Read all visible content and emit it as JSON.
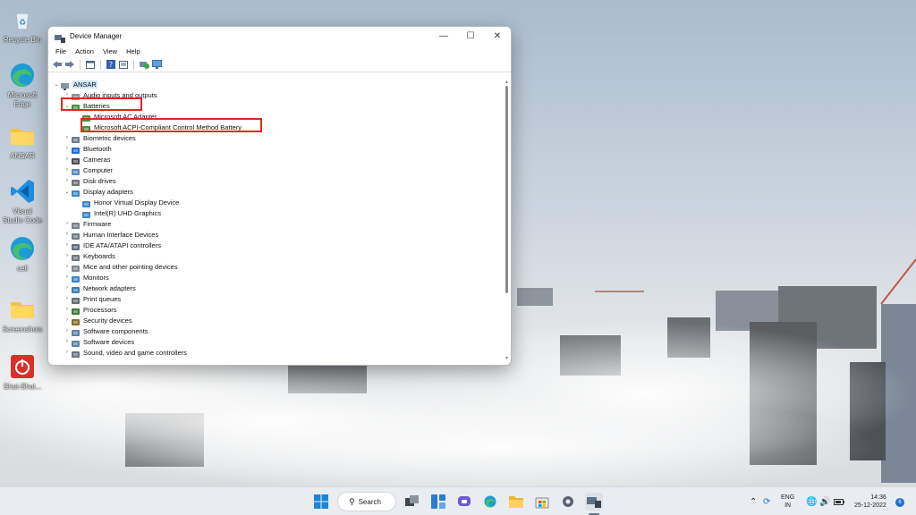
{
  "desktop": {
    "icons": [
      {
        "label": "Recycle Bin",
        "icon": "recycle-bin-icon"
      },
      {
        "label": "Microsoft Edge",
        "icon": "edge-icon"
      },
      {
        "label": "ANSAR",
        "icon": "folder-icon"
      },
      {
        "label": "Visual Studio Code",
        "icon": "vscode-icon"
      },
      {
        "label": "cell",
        "icon": "edge-icon"
      },
      {
        "label": "Screenshots",
        "icon": "folder-icon"
      },
      {
        "label": "Shut-Shut...",
        "icon": "power-icon"
      }
    ]
  },
  "window": {
    "title": "Device Manager",
    "controls": {
      "minimize": "—",
      "maximize": "☐",
      "close": "✕"
    },
    "menu": [
      "File",
      "Action",
      "View",
      "Help"
    ],
    "toolbar_icons": [
      "back-icon",
      "forward-icon",
      "properties-icon",
      "help-icon",
      "view-icon",
      "update-driver-icon",
      "monitor-icon"
    ]
  },
  "tree": {
    "root": "ANSAR",
    "items": [
      {
        "label": "Audio inputs and outputs",
        "icon": "speaker-icon",
        "expanded": false,
        "level": 1
      },
      {
        "label": "Batteries",
        "icon": "battery-icon",
        "expanded": true,
        "level": 1
      },
      {
        "label": "Microsoft AC Adapter",
        "icon": "battery-icon",
        "level": 2
      },
      {
        "label": "Microsoft ACPI-Compliant Control Method Battery",
        "icon": "battery-icon",
        "level": 2
      },
      {
        "label": "Biometric devices",
        "icon": "biometric-icon",
        "expanded": false,
        "level": 1
      },
      {
        "label": "Bluetooth",
        "icon": "bluetooth-icon",
        "expanded": false,
        "level": 1
      },
      {
        "label": "Cameras",
        "icon": "camera-icon",
        "expanded": false,
        "level": 1
      },
      {
        "label": "Computer",
        "icon": "computer-icon",
        "expanded": false,
        "level": 1
      },
      {
        "label": "Disk drives",
        "icon": "disk-icon",
        "expanded": false,
        "level": 1
      },
      {
        "label": "Display adapters",
        "icon": "display-icon",
        "expanded": true,
        "level": 1
      },
      {
        "label": "Honor Virtual Display Device",
        "icon": "display-icon",
        "level": 2
      },
      {
        "label": "Intel(R) UHD Graphics",
        "icon": "display-icon",
        "level": 2
      },
      {
        "label": "Firmware",
        "icon": "firmware-icon",
        "expanded": false,
        "level": 1
      },
      {
        "label": "Human Interface Devices",
        "icon": "hid-icon",
        "expanded": false,
        "level": 1
      },
      {
        "label": "IDE ATA/ATAPI controllers",
        "icon": "ide-icon",
        "expanded": false,
        "level": 1
      },
      {
        "label": "Keyboards",
        "icon": "keyboard-icon",
        "expanded": false,
        "level": 1
      },
      {
        "label": "Mice and other pointing devices",
        "icon": "mouse-icon",
        "expanded": false,
        "level": 1
      },
      {
        "label": "Monitors",
        "icon": "monitor-icon",
        "expanded": false,
        "level": 1
      },
      {
        "label": "Network adapters",
        "icon": "network-icon",
        "expanded": false,
        "level": 1
      },
      {
        "label": "Print queues",
        "icon": "printer-icon",
        "expanded": false,
        "level": 1
      },
      {
        "label": "Processors",
        "icon": "processor-icon",
        "expanded": false,
        "level": 1
      },
      {
        "label": "Security devices",
        "icon": "security-icon",
        "expanded": false,
        "level": 1
      },
      {
        "label": "Software components",
        "icon": "software-icon",
        "expanded": false,
        "level": 1
      },
      {
        "label": "Software devices",
        "icon": "software-icon",
        "expanded": false,
        "level": 1
      },
      {
        "label": "Sound, video and game controllers",
        "icon": "sound-icon",
        "expanded": false,
        "level": 1
      }
    ]
  },
  "taskbar": {
    "search_label": "Search",
    "apps": [
      "start-icon",
      "task-view-icon",
      "widgets-icon",
      "chat-icon",
      "edge-icon",
      "file-explorer-icon",
      "store-icon",
      "settings-icon",
      "device-manager-icon"
    ],
    "language": "ENG",
    "region": "IN",
    "time": "14:36",
    "date": "25-12-2022",
    "notification_count": "6"
  },
  "colors": {
    "highlight_box": "#e02a1a",
    "taskbar_bg": "#e9ecf1",
    "selection_bg": "#cfe6fb"
  }
}
